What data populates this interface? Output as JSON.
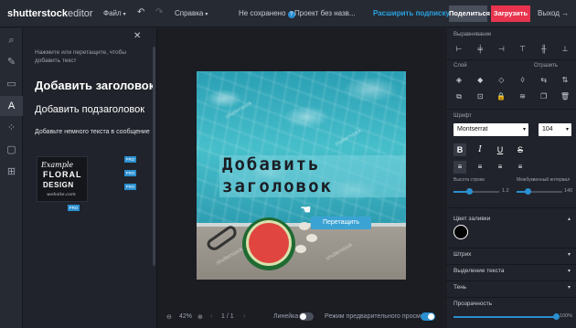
{
  "header": {
    "logo_main": "shutterstock",
    "logo_sub": "editor",
    "menu_file": "Файл",
    "menu_help": "Справка",
    "status": "Не сохранено",
    "project_name": "Проект без назв...",
    "upgrade": "Расширить подписку",
    "share": "Поделиться",
    "download": "Загрузить",
    "exit": "Выход"
  },
  "left_panel": {
    "hint": "Нажмите или перетащите, чтобы добавить текст",
    "add_heading": "Добавить заголовок",
    "add_subheading": "Добавить подзаголовок",
    "add_text": "Добавьте немного текста в сообщение",
    "sample": {
      "line1": "Example",
      "line2": "FLORAL",
      "line3": "DESIGN",
      "line4": "website.com"
    },
    "pro_badge": "PRO"
  },
  "canvas": {
    "headline": "Добавить заголовок",
    "tooltip": "Перетащить",
    "watermark": "shutterstock"
  },
  "bottom": {
    "zoom": "42%",
    "page": "1 / 1",
    "ruler_label": "Линейка",
    "preview_label": "Режим предварительного просмотра",
    "ruler_on": false,
    "preview_on": true
  },
  "right_panel": {
    "align_label": "Выравнивание",
    "layer_label": "Слой",
    "reflect_label": "Отразить",
    "font_label": "Шрифт",
    "font_family": "Montserrat",
    "font_size": "104",
    "line_height_label": "Высота строки",
    "line_height_value": "1.2",
    "line_height_fraction": 0.35,
    "letter_spacing_label": "Межбуквенный интервал",
    "letter_spacing_value": "140",
    "letter_spacing_fraction": 0.25,
    "fill_label": "Цвет заливки",
    "fill_color": "#000000",
    "stroke_label": "Штрих",
    "highlight_label": "Выделение текста",
    "shadow_label": "Тень",
    "opacity_label": "Прозрачность",
    "opacity_value": "100%",
    "opacity_fraction": 1.0
  },
  "colors": {
    "accent": "#2a8fd0",
    "download": "#e8344e",
    "upgrade": "#2aa2e0"
  }
}
